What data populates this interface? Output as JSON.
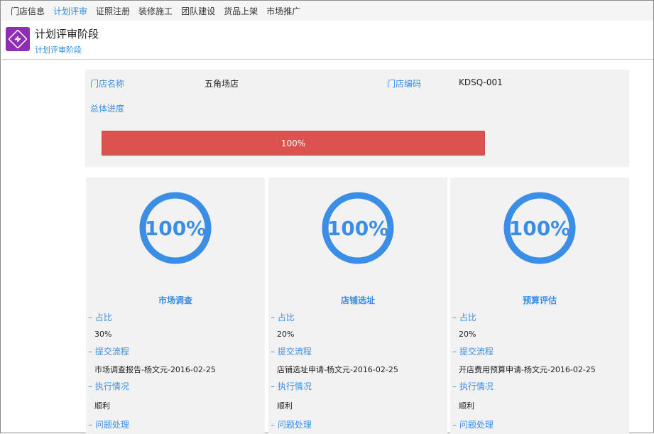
{
  "nav": {
    "tabs": [
      {
        "label": "门店信息",
        "active": false
      },
      {
        "label": "计划评审",
        "active": true
      },
      {
        "label": "证照注册",
        "active": false
      },
      {
        "label": "装修施工",
        "active": false
      },
      {
        "label": "团队建设",
        "active": false
      },
      {
        "label": "货品上架",
        "active": false
      },
      {
        "label": "市场推广",
        "active": false
      }
    ]
  },
  "header": {
    "title": "计划评审阶段",
    "breadcrumb": "计划评审阶段",
    "logo_icon": "sync-arrows-icon",
    "logo_color": "#8e2fb3"
  },
  "store": {
    "name_label": "门店名称",
    "name_value": "五角场店",
    "code_label": "门店编码",
    "code_value": "KDSQ-001",
    "progress_label": "总体进度",
    "progress_text": "100%",
    "progress_fraction": 1.0,
    "progress_color": "#db524f"
  },
  "cards": [
    {
      "percent_text": "100%",
      "percent_fraction": 1.0,
      "title": "市场调查",
      "ratio_label": "– 占比",
      "ratio_value": "30%",
      "flow_label": "– 提交流程",
      "flow_value": "市场调查报告-杨文元-2016-02-25",
      "exec_label": "– 执行情况",
      "exec_value": "顺利",
      "issue_label": "– 问题处理"
    },
    {
      "percent_text": "100%",
      "percent_fraction": 1.0,
      "title": "店铺选址",
      "ratio_label": "– 占比",
      "ratio_value": "20%",
      "flow_label": "– 提交流程",
      "flow_value": "店铺选址申请-杨文元-2016-02-25",
      "exec_label": "– 执行情况",
      "exec_value": "顺利",
      "issue_label": "– 问题处理"
    },
    {
      "percent_text": "100%",
      "percent_fraction": 1.0,
      "title": "预算评估",
      "ratio_label": "– 占比",
      "ratio_value": "20%",
      "flow_label": "– 提交流程",
      "flow_value": "开店费用预算申请-杨文元-2016-02-25",
      "exec_label": "– 执行情况",
      "exec_value": "顺利",
      "issue_label": "– 问题处理"
    }
  ],
  "ring_color": "#3a8ee6"
}
